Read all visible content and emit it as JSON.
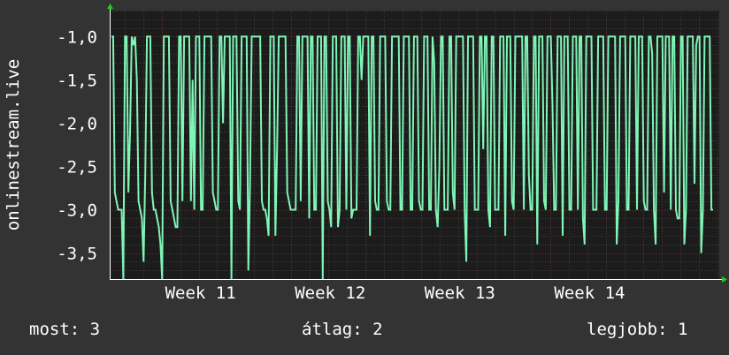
{
  "colors": {
    "background": "#333333",
    "plot_background": "#1c1c1c",
    "grid_major": "#6a3434",
    "grid_minor": "#4a3a3a",
    "line": "#7ff5b6",
    "axis_arrow": "#22cc22",
    "text": "#ffffff"
  },
  "footer": {
    "now": "most: 3",
    "avg": "átlag: 2",
    "best": "legjobb: 1"
  },
  "chart_data": {
    "type": "line",
    "title": "",
    "ylabel": "onlinestream.live",
    "xlabel": "",
    "y_ticks": [
      "-1,0",
      "-1,5",
      "-2,0",
      "-2,5",
      "-3,0",
      "-3,5"
    ],
    "y_tick_values": [
      -1.0,
      -1.5,
      -2.0,
      -2.5,
      -3.0,
      -3.5
    ],
    "x_tick_labels": [
      "Week 11",
      "Week 12",
      "Week 13",
      "Week 14"
    ],
    "x_tick_positions_weeks": [
      11,
      12,
      13,
      14
    ],
    "xlim_weeks": [
      10.6,
      15.3
    ],
    "ylim": [
      -3.8,
      -0.7
    ],
    "grid": true,
    "series": [
      {
        "values": [
          -1,
          -1,
          -2.8,
          -2.9,
          -3,
          -3,
          -3,
          -3.8,
          -1,
          -1,
          -2.8,
          -2.1,
          -1,
          -1.1,
          -1,
          -1.5,
          -2.9,
          -3,
          -3.1,
          -3.6,
          -2.6,
          -1,
          -1,
          -1,
          -2.8,
          -3,
          -3,
          -3.1,
          -3.2,
          -3.4,
          -3.8,
          -1,
          -1,
          -1,
          -1,
          -2.9,
          -3,
          -3.1,
          -3.2,
          -3.2,
          -1,
          -1,
          -2.9,
          -1,
          -1,
          -1,
          -1,
          -2.9,
          -1.5,
          -3,
          -1,
          -1,
          -1,
          -3,
          -3,
          -1,
          -1,
          -1,
          -1,
          -1,
          -2.8,
          -2.9,
          -3,
          -3,
          -1,
          -1,
          -2,
          -1,
          -1,
          -1,
          -1,
          -3.8,
          -1,
          -1,
          -1,
          -2.9,
          -3,
          -1,
          -1,
          -1,
          -1,
          -3.7,
          -2.7,
          -1,
          -1,
          -1,
          -1,
          -1,
          -1,
          -2.9,
          -3,
          -3,
          -3.1,
          -3.3,
          -1,
          -1,
          -1,
          -3.3,
          -2.3,
          -1,
          -1,
          -1,
          -1,
          -1,
          -2.8,
          -2.9,
          -3,
          -3,
          -3,
          -3,
          -1,
          -1,
          -2.9,
          -1,
          -1,
          -1,
          -1,
          -3.1,
          -1,
          -1,
          -3,
          -3,
          -1,
          -1,
          -1,
          -3.8,
          -1,
          -1,
          -2.9,
          -3,
          -3.2,
          -1,
          -1,
          -1,
          -3.2,
          -3,
          -1,
          -1,
          -1,
          -3,
          -1,
          -1,
          -3.1,
          -3,
          -3,
          -3,
          -1,
          -1,
          -1.5,
          -1,
          -1,
          -1,
          -1,
          -3.3,
          -1,
          -1,
          -2.9,
          -3,
          -3,
          -1,
          -1,
          -1,
          -1,
          -2.9,
          -3,
          -3,
          -1,
          -1,
          -1,
          -1,
          -1,
          -3,
          -3,
          -1,
          -1,
          -1,
          -1,
          -3,
          -3,
          -1,
          -1,
          -1,
          -2.9,
          -3,
          -3,
          -1,
          -1,
          -1,
          -3,
          -3,
          -1,
          -1.3,
          -3,
          -3.2,
          -2.5,
          -1,
          -1,
          -3,
          -3,
          -3,
          -1,
          -1,
          -2.8,
          -3,
          -1,
          -1,
          -1,
          -1,
          -1,
          -3,
          -3.6,
          -1,
          -1,
          -1,
          -1,
          -3,
          -3,
          -3,
          -1,
          -1,
          -2.3,
          -1,
          -1,
          -3,
          -3.2,
          -1,
          -1,
          -3,
          -3,
          -3,
          -1,
          -1,
          -1,
          -3.3,
          -1,
          -1,
          -1,
          -2.9,
          -3,
          -1,
          -1,
          -1,
          -1,
          -1,
          -3,
          -1,
          -1,
          -2.6,
          -3,
          -3,
          -1,
          -1,
          -3.4,
          -1,
          -1,
          -1,
          -2.9,
          -3,
          -1,
          -1,
          -1,
          -1.8,
          -3,
          -3,
          -1,
          -1,
          -1,
          -3.3,
          -1,
          -1,
          -1,
          -3,
          -3,
          -1,
          -1,
          -1,
          -3,
          -1,
          -1,
          -3.1,
          -3.4,
          -1,
          -1,
          -1,
          -1,
          -3,
          -3,
          -3,
          -1,
          -1,
          -1,
          -1,
          -3,
          -3,
          -1,
          -1,
          -1,
          -1,
          -1,
          -3.4,
          -2.9,
          -1,
          -1,
          -1,
          -1,
          -3,
          -3,
          -1,
          -1,
          -1,
          -1,
          -3,
          -1,
          -1,
          -1,
          -2.9,
          -3,
          -3,
          -1,
          -1,
          -1.2,
          -3,
          -3.4,
          -1,
          -1,
          -1,
          -1,
          -2.8,
          -1,
          -1,
          -1,
          -3,
          -1,
          -1,
          -3,
          -3.1,
          -3.1,
          -1,
          -1,
          -3.4,
          -3,
          -1,
          -1,
          -1,
          -1,
          -2.7,
          -1.1,
          -1,
          -1,
          -3.5,
          -3,
          -1,
          -1,
          -1,
          -1,
          -3,
          -3
        ]
      }
    ]
  }
}
